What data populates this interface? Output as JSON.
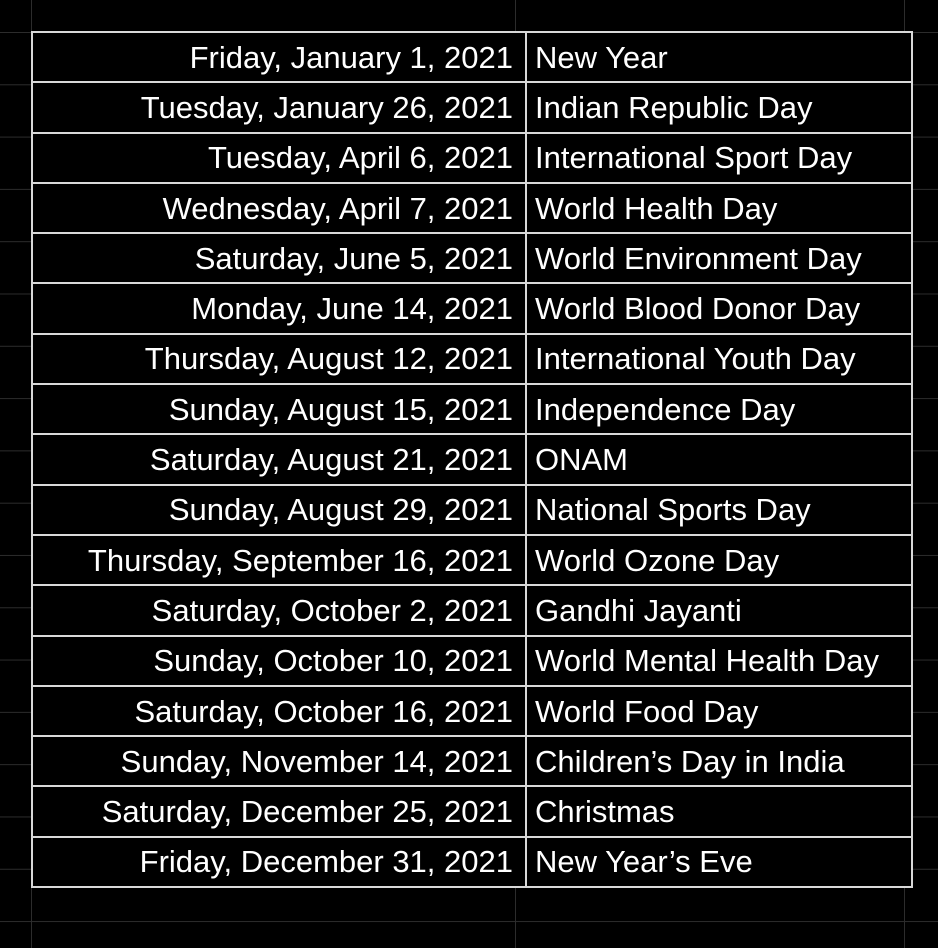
{
  "holidays": [
    {
      "date": "Friday, January 1, 2021",
      "name": "New Year"
    },
    {
      "date": "Tuesday, January 26, 2021",
      "name": "Indian Republic Day"
    },
    {
      "date": "Tuesday, April 6, 2021",
      "name": "International Sport Day"
    },
    {
      "date": "Wednesday, April 7, 2021",
      "name": "World Health Day"
    },
    {
      "date": "Saturday, June 5, 2021",
      "name": "World Environment Day"
    },
    {
      "date": "Monday, June 14, 2021",
      "name": "World Blood Donor Day"
    },
    {
      "date": "Thursday, August 12, 2021",
      "name": "International Youth Day"
    },
    {
      "date": "Sunday, August 15, 2021",
      "name": "Independence Day"
    },
    {
      "date": "Saturday, August 21, 2021",
      "name": "ONAM"
    },
    {
      "date": "Sunday, August 29, 2021",
      "name": "National Sports Day"
    },
    {
      "date": "Thursday, September 16, 2021",
      "name": "World Ozone Day"
    },
    {
      "date": "Saturday, October 2, 2021",
      "name": "Gandhi Jayanti"
    },
    {
      "date": "Sunday, October 10, 2021",
      "name": "World Mental Health Day"
    },
    {
      "date": "Saturday, October 16, 2021",
      "name": "World Food Day"
    },
    {
      "date": "Sunday, November 14, 2021",
      "name": "Children’s Day in India"
    },
    {
      "date": "Saturday, December 25, 2021",
      "name": "Christmas"
    },
    {
      "date": "Friday, December 31, 2021",
      "name": "New Year’s Eve"
    }
  ],
  "colors": {
    "background": "#000000",
    "text": "#ffffff",
    "border": "#d8d8d8",
    "grid": "#2c2c2c"
  }
}
